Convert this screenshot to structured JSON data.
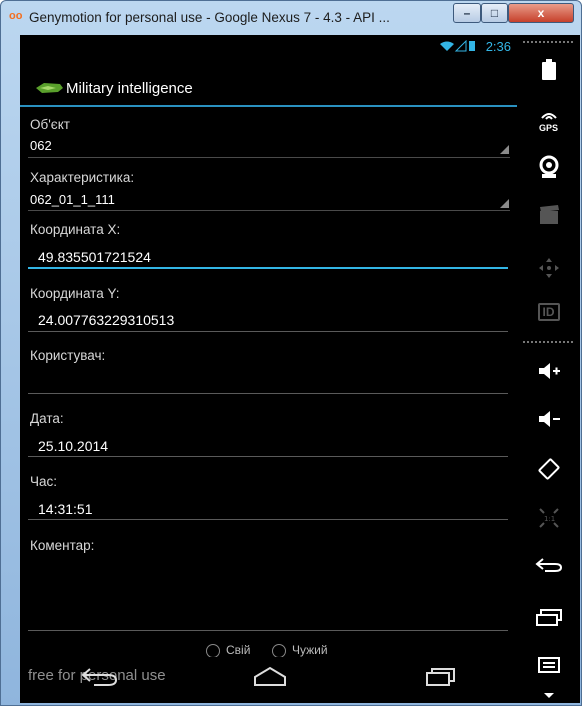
{
  "window": {
    "title": "Genymotion for personal use - Google Nexus 7 - 4.3 - API ...",
    "minimize_glyph": "–",
    "maximize_glyph": "□",
    "close_glyph": "x"
  },
  "status": {
    "time": "2:36"
  },
  "app": {
    "title": "Military intelligence"
  },
  "form": {
    "object_label": "Об'єкт",
    "object_value": "062",
    "characteristic_label": "Характеристика:",
    "characteristic_value": "062_01_1_111",
    "coord_x_label": "Координата X:",
    "coord_x_value": "49.835501721524",
    "coord_y_label": "Координата Y:",
    "coord_y_value": "24.007763229310513",
    "user_label": "Користувач:",
    "user_value": "",
    "date_label": "Дата:",
    "date_value": "25.10.2014",
    "time_label": "Час:",
    "time_value": "14:31:51",
    "comment_label": "Коментар:",
    "comment_value": "",
    "radio_own": "Свій",
    "radio_foreign": "Чужий"
  },
  "navbar": {
    "watermark": "free for personal use"
  },
  "sidebar": {
    "gps_label": "GPS",
    "id_label": "ID"
  },
  "colors": {
    "accent": "#33b5e5",
    "background": "#000000",
    "window_frame": "#a9c7e6",
    "close_button": "#c6402b"
  }
}
